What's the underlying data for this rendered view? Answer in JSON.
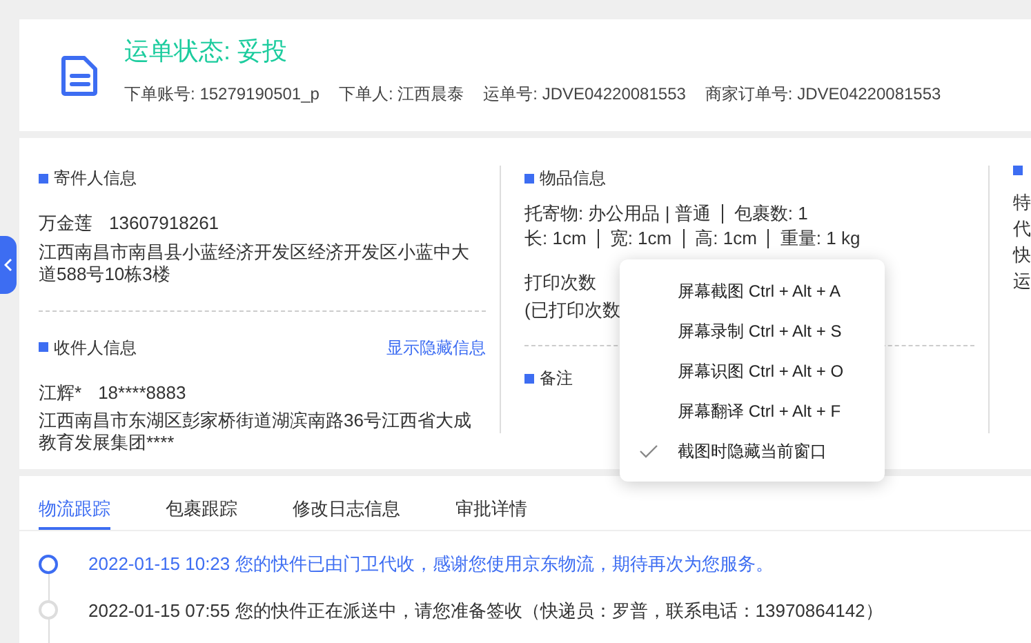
{
  "header": {
    "title": "运单状态: 妥投",
    "meta": [
      {
        "label": "下单账号:",
        "value": "15279190501_p"
      },
      {
        "label": "下单人:",
        "value": "江西晨泰"
      },
      {
        "label": "运单号:",
        "value": "JDVE04220081553"
      },
      {
        "label": "商家订单号:",
        "value": "JDVE04220081553"
      }
    ]
  },
  "sender": {
    "title": "寄件人信息",
    "name": "万金莲",
    "phone": "13607918261",
    "address": "江西南昌市南昌县小蓝经济开发区经济开发区小蓝中大道588号10栋3楼"
  },
  "receiver": {
    "title": "收件人信息",
    "link": "显示隐藏信息",
    "name": "江辉*",
    "phone": "18****8883",
    "address": "江西南昌市东湖区彭家桥街道湖滨南路36号江西省大成教育发展集团****"
  },
  "goods": {
    "title": "物品信息",
    "line_1": [
      "托寄物: 办公用品 | 普通",
      "包裹数: 1"
    ],
    "line_2": [
      "长: 1cm",
      "宽: 1cm",
      "高: 1cm",
      "重量: 1 kg"
    ],
    "print_label": "打印次数",
    "print_note": "(已打印次数"
  },
  "remark": {
    "title": "备注"
  },
  "column_3": {
    "lines": [
      "特",
      "代",
      "快",
      "运"
    ]
  },
  "context_menu": {
    "items": [
      {
        "label": "屏幕截图 Ctrl + Alt + A",
        "checked": false
      },
      {
        "label": "屏幕录制 Ctrl + Alt + S",
        "checked": false
      },
      {
        "label": "屏幕识图 Ctrl + Alt + O",
        "checked": false
      },
      {
        "label": "屏幕翻译 Ctrl + Alt + F",
        "checked": false
      },
      {
        "label": "截图时隐藏当前窗口",
        "checked": true
      }
    ]
  },
  "tabs": [
    {
      "label": "物流跟踪",
      "selected": true
    },
    {
      "label": "包裹跟踪",
      "selected": false
    },
    {
      "label": "修改日志信息",
      "selected": false
    },
    {
      "label": "审批详情",
      "selected": false
    }
  ],
  "timeline": [
    {
      "text": "2022-01-15 10:23 您的快件已由门卫代收，感谢您使用京东物流，期待再次为您服务。",
      "selected": true
    },
    {
      "text": "2022-01-15 07:55 您的快件正在派送中，请您准备签收（快递员：罗普，联系电话：13970864142）",
      "selected": false
    }
  ]
}
